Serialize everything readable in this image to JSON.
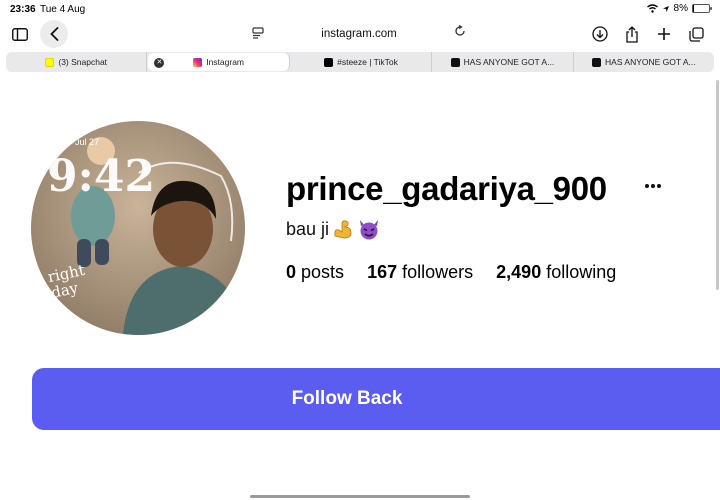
{
  "status_bar": {
    "time": "23:36",
    "date": "Tue 4 Aug",
    "battery": "8%",
    "battery_level": 0.08
  },
  "browser": {
    "address": "instagram.com",
    "tabs": [
      {
        "label": "(3) Snapchat",
        "icon": "snapchat-icon",
        "color": "#fffc00"
      },
      {
        "label": "Instagram",
        "icon": "instagram-icon",
        "color": "#d6249f",
        "active": true
      },
      {
        "label": "#steeze | TikTok",
        "icon": "tiktok-icon",
        "color": "#000000"
      },
      {
        "label": "HAS ANYONE GOT A...",
        "icon": "site-icon",
        "color": "#111111"
      },
      {
        "label": "HAS ANYONE GOT A...",
        "icon": "site-icon",
        "color": "#111111"
      }
    ]
  },
  "profile": {
    "avatar_text": "9:42",
    "avatar_date": "Jul 27",
    "avatar_caption": "right day",
    "username": "prince_gadariya_900",
    "bio": "bau ji",
    "bio_emojis": [
      "muscle-emoji",
      "devil-emoji"
    ],
    "stats": {
      "posts_count": "0",
      "posts_label": "posts",
      "followers_count": "167",
      "followers_label": "followers",
      "following_count": "2,490",
      "following_label": "following"
    },
    "follow_label": "Follow Back"
  },
  "colors": {
    "accent": "#5b5cf0"
  }
}
